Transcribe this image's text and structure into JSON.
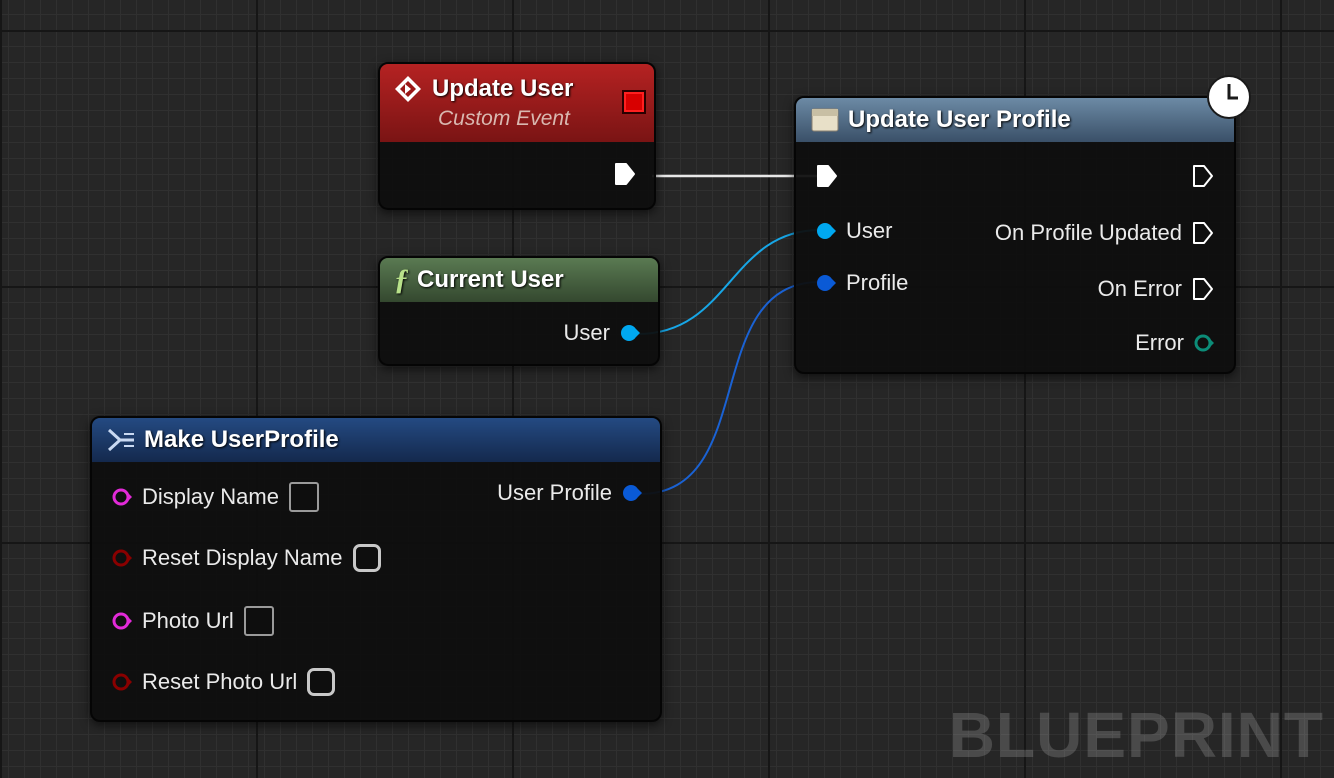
{
  "nodes": {
    "update_user": {
      "title": "Update User",
      "subtitle": "Custom Event"
    },
    "current_user": {
      "title": "Current User",
      "output": "User"
    },
    "make_profile": {
      "title": "Make UserProfile",
      "output": "User Profile",
      "inputs": [
        "Display Name",
        "Reset Display Name",
        "Photo Url",
        "Reset Photo Url"
      ]
    },
    "update_profile": {
      "title": "Update User Profile",
      "inputs": [
        "User",
        "Profile"
      ],
      "outputs": [
        "On Profile Updated",
        "On Error",
        "Error"
      ]
    }
  },
  "colors": {
    "exec": "#ffffff",
    "user_object": "#00a8f0",
    "struct": "#0a5ad6",
    "string": "#e22ad8",
    "bool": "#8a0000",
    "error": "#0c8c78"
  },
  "watermark": "BLUEPRINT"
}
